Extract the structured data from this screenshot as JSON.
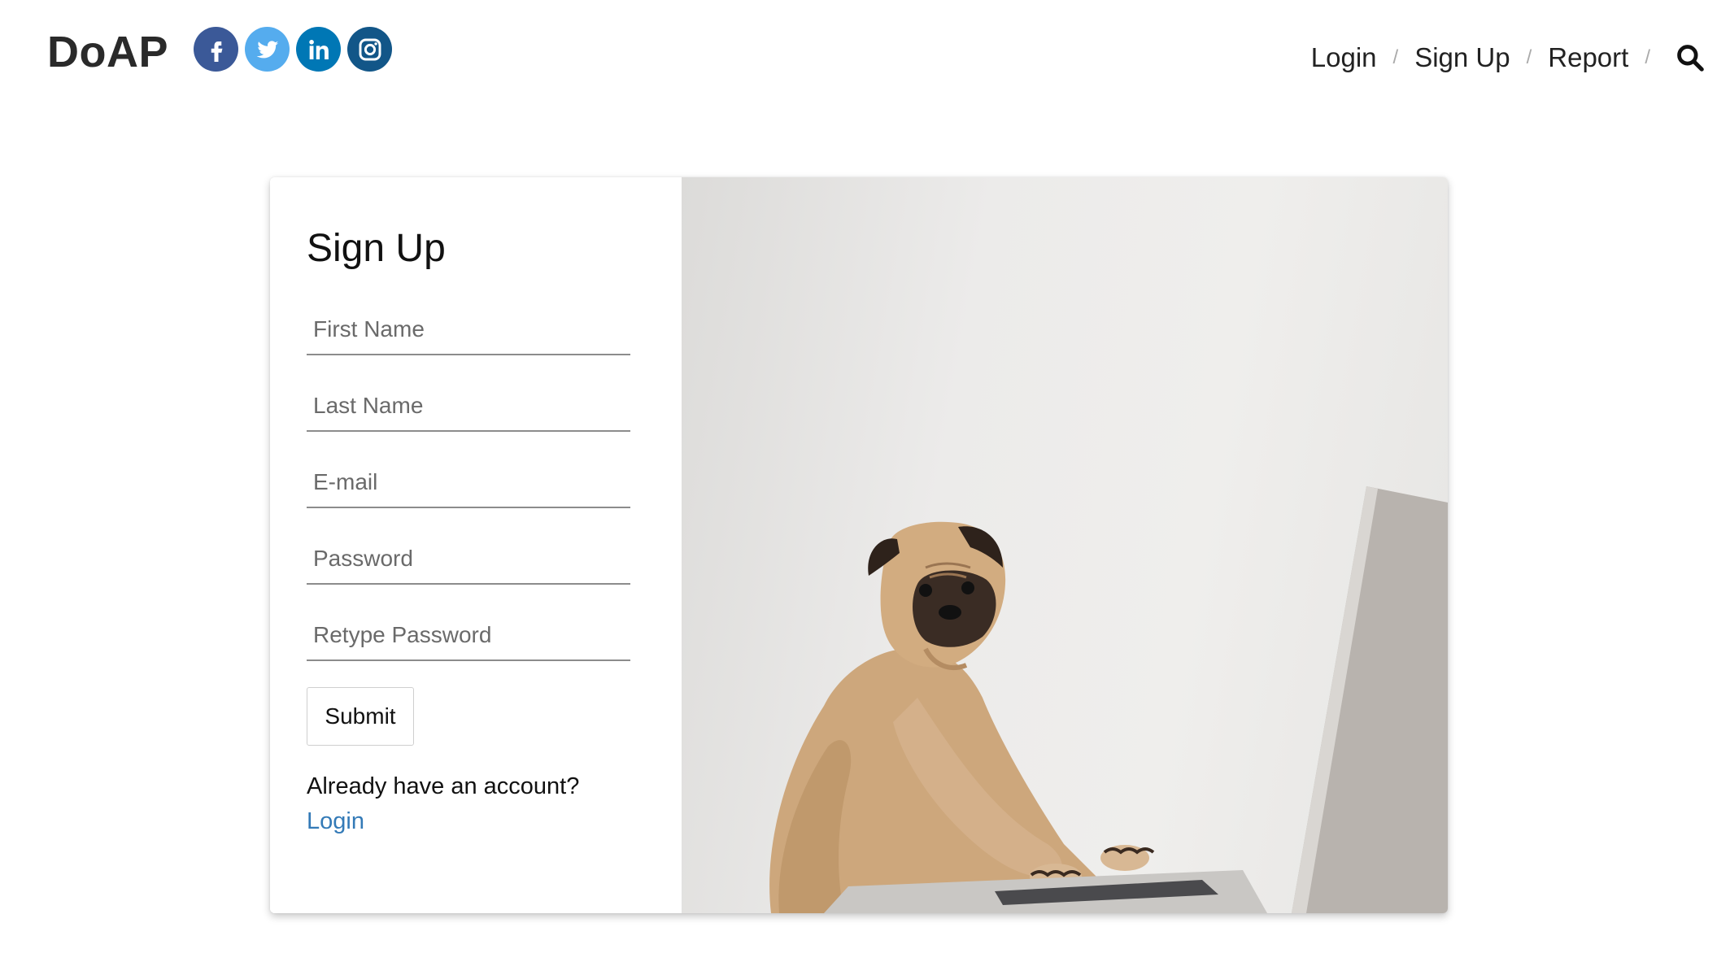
{
  "header": {
    "brand": "DoAP",
    "social": [
      {
        "name": "facebook-icon"
      },
      {
        "name": "twitter-icon"
      },
      {
        "name": "linkedin-icon"
      },
      {
        "name": "instagram-icon"
      }
    ],
    "nav": {
      "login": "Login",
      "signup": "Sign Up",
      "report": "Report",
      "separator": "/"
    },
    "search_icon": "search-icon"
  },
  "form": {
    "title": "Sign Up",
    "first_name_placeholder": "First Name",
    "last_name_placeholder": "Last Name",
    "email_placeholder": "E-mail",
    "password_placeholder": "Password",
    "retype_password_placeholder": "Retype Password",
    "submit_label": "Submit",
    "already_text": "Already have an account?",
    "login_link": "Login"
  },
  "colors": {
    "facebook": "#3b5998",
    "twitter": "#55acee",
    "linkedin": "#0077b5",
    "instagram": "#125688",
    "link": "#337ab7"
  }
}
